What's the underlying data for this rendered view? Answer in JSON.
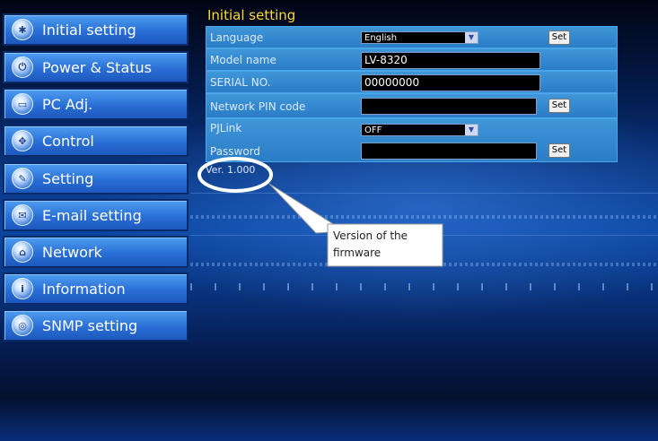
{
  "sidebar": {
    "items": [
      {
        "label": "Initial setting"
      },
      {
        "label": "Power & Status"
      },
      {
        "label": "PC Adj."
      },
      {
        "label": "Control"
      },
      {
        "label": "Setting"
      },
      {
        "label": "E-mail setting"
      },
      {
        "label": "Network"
      },
      {
        "label": "Information"
      },
      {
        "label": "SNMP setting"
      }
    ]
  },
  "panel": {
    "title": "Initial setting",
    "language_label": "Language",
    "language_value": "English",
    "model_label": "Model name",
    "model_value": "LV-8320",
    "serial_label": "SERIAL NO.",
    "serial_value": "00000000",
    "pin_label": "Network PIN code",
    "pin_value": "",
    "pjlink_label": "PJLink",
    "pjlink_value": "OFF",
    "password_label": "Password",
    "password_value": "",
    "set_label": "Set"
  },
  "version": "Ver. 1.000",
  "callout": "Version of the firmware"
}
